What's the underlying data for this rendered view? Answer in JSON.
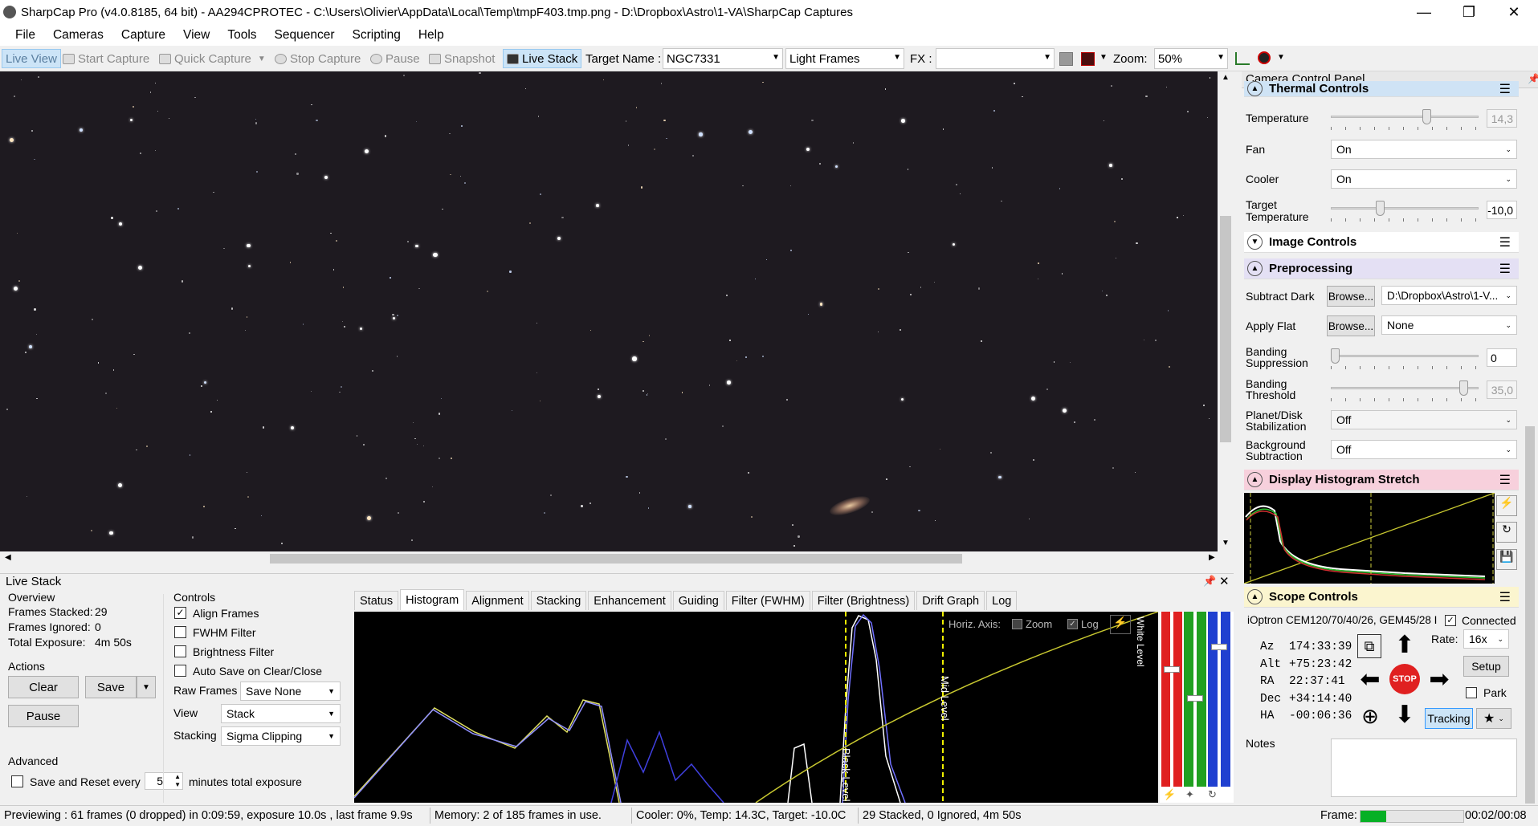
{
  "window": {
    "title": "SharpCap Pro (v4.0.8185, 64 bit) - AA294CPROTEC - C:\\Users\\Olivier\\AppData\\Local\\Temp\\tmpF403.tmp.png - D:\\Dropbox\\Astro\\1-VA\\SharpCap Captures",
    "minimize": "—",
    "restore": "❐",
    "close": "✕"
  },
  "menu": [
    "File",
    "Cameras",
    "Capture",
    "View",
    "Tools",
    "Sequencer",
    "Scripting",
    "Help"
  ],
  "toolbar": {
    "live_view": "Live View",
    "start_capture": "Start Capture",
    "quick_capture": "Quick Capture",
    "stop_capture": "Stop Capture",
    "pause": "Pause",
    "snapshot": "Snapshot",
    "live_stack": "Live Stack",
    "target_name_label": "Target Name :",
    "target_name_value": "NGC7331",
    "frame_type": "Light Frames",
    "fx_label": "FX :",
    "fx_value": "",
    "zoom_label": "Zoom:",
    "zoom_value": "50%"
  },
  "live_stack": {
    "title": "Live Stack",
    "overview": {
      "heading": "Overview",
      "frames_stacked_label": "Frames Stacked:",
      "frames_stacked": "29",
      "frames_ignored_label": "Frames Ignored:",
      "frames_ignored": "0",
      "total_exposure_label": "Total Exposure:",
      "total_exposure": "4m 50s"
    },
    "actions": {
      "heading": "Actions",
      "clear": "Clear",
      "save": "Save",
      "pause": "Pause"
    },
    "advanced": {
      "heading": "Advanced",
      "save_reset_label": "Save and Reset every",
      "save_reset_value": "5",
      "minutes_label": "minutes total exposure"
    },
    "controls": {
      "heading": "Controls",
      "align_frames": "Align Frames",
      "fwhm_filter": "FWHM Filter",
      "brightness_filter": "Brightness Filter",
      "auto_save": "Auto Save on Clear/Close",
      "raw_frames_label": "Raw Frames",
      "raw_frames_value": "Save None",
      "view_label": "View",
      "view_value": "Stack",
      "stacking_label": "Stacking",
      "stacking_value": "Sigma Clipping"
    },
    "tabs": [
      "Status",
      "Histogram",
      "Alignment",
      "Stacking",
      "Enhancement",
      "Guiding",
      "Filter (FWHM)",
      "Filter (Brightness)",
      "Drift Graph",
      "Log"
    ],
    "histogram": {
      "horiz_axis_label": "Horiz. Axis:",
      "zoom_label": "Zoom",
      "log_label": "Log",
      "black_level": "Black Level",
      "mid_level": "Mid Level",
      "white_level": "White Level"
    }
  },
  "ccp": {
    "title": "Camera Control Panel",
    "thermal": {
      "heading": "Thermal Controls",
      "temperature_label": "Temperature",
      "temperature_value": "14,3",
      "fan_label": "Fan",
      "fan_value": "On",
      "cooler_label": "Cooler",
      "cooler_value": "On",
      "target_temp_label_1": "Target",
      "target_temp_label_2": "Temperature",
      "target_temp_value": "-10,0"
    },
    "image_controls": {
      "heading": "Image Controls"
    },
    "preprocessing": {
      "heading": "Preprocessing",
      "subtract_dark_label": "Subtract Dark",
      "browse": "Browse...",
      "subtract_dark_value": "D:\\Dropbox\\Astro\\1-V...",
      "apply_flat_label": "Apply Flat",
      "apply_flat_value": "None",
      "banding_supp_1": "Banding",
      "banding_supp_2": "Suppression",
      "banding_supp_value": "0",
      "banding_thr_1": "Banding",
      "banding_thr_2": "Threshold",
      "banding_thr_value": "35,0",
      "planet_1": "Planet/Disk",
      "planet_2": "Stabilization",
      "planet_value": "Off",
      "bg_1": "Background",
      "bg_2": "Subtraction",
      "bg_value": "Off"
    },
    "histogram_stretch": {
      "heading": "Display Histogram Stretch"
    },
    "scope": {
      "heading": "Scope Controls",
      "mount": "iOptron CEM120/70/40/26, GEM45/28 I",
      "connected_label": "Connected",
      "az_label": "Az",
      "az": "174:33:39",
      "alt_label": "Alt",
      "alt": "+75:23:42",
      "ra_label": "RA",
      "ra": "22:37:41",
      "dec_label": "Dec",
      "dec": "+34:14:40",
      "ha_label": "HA",
      "ha": "-00:06:36",
      "rate_label": "Rate:",
      "rate_value": "16x",
      "setup": "Setup",
      "park": "Park",
      "tracking": "Tracking",
      "stop": "STOP"
    },
    "notes_label": "Notes"
  },
  "status": {
    "preview": "Previewing : 61 frames (0 dropped) in 0:09:59, exposure 10.0s , last frame 9.9s",
    "memory": "Memory: 2 of 185 frames in use.",
    "cooler": "Cooler: 0%, Temp: 14.3C, Target: -10.0C",
    "stack": "29 Stacked, 0 Ignored, 4m 50s",
    "frame_label": "Frame:",
    "time": "00:02/00:08"
  }
}
